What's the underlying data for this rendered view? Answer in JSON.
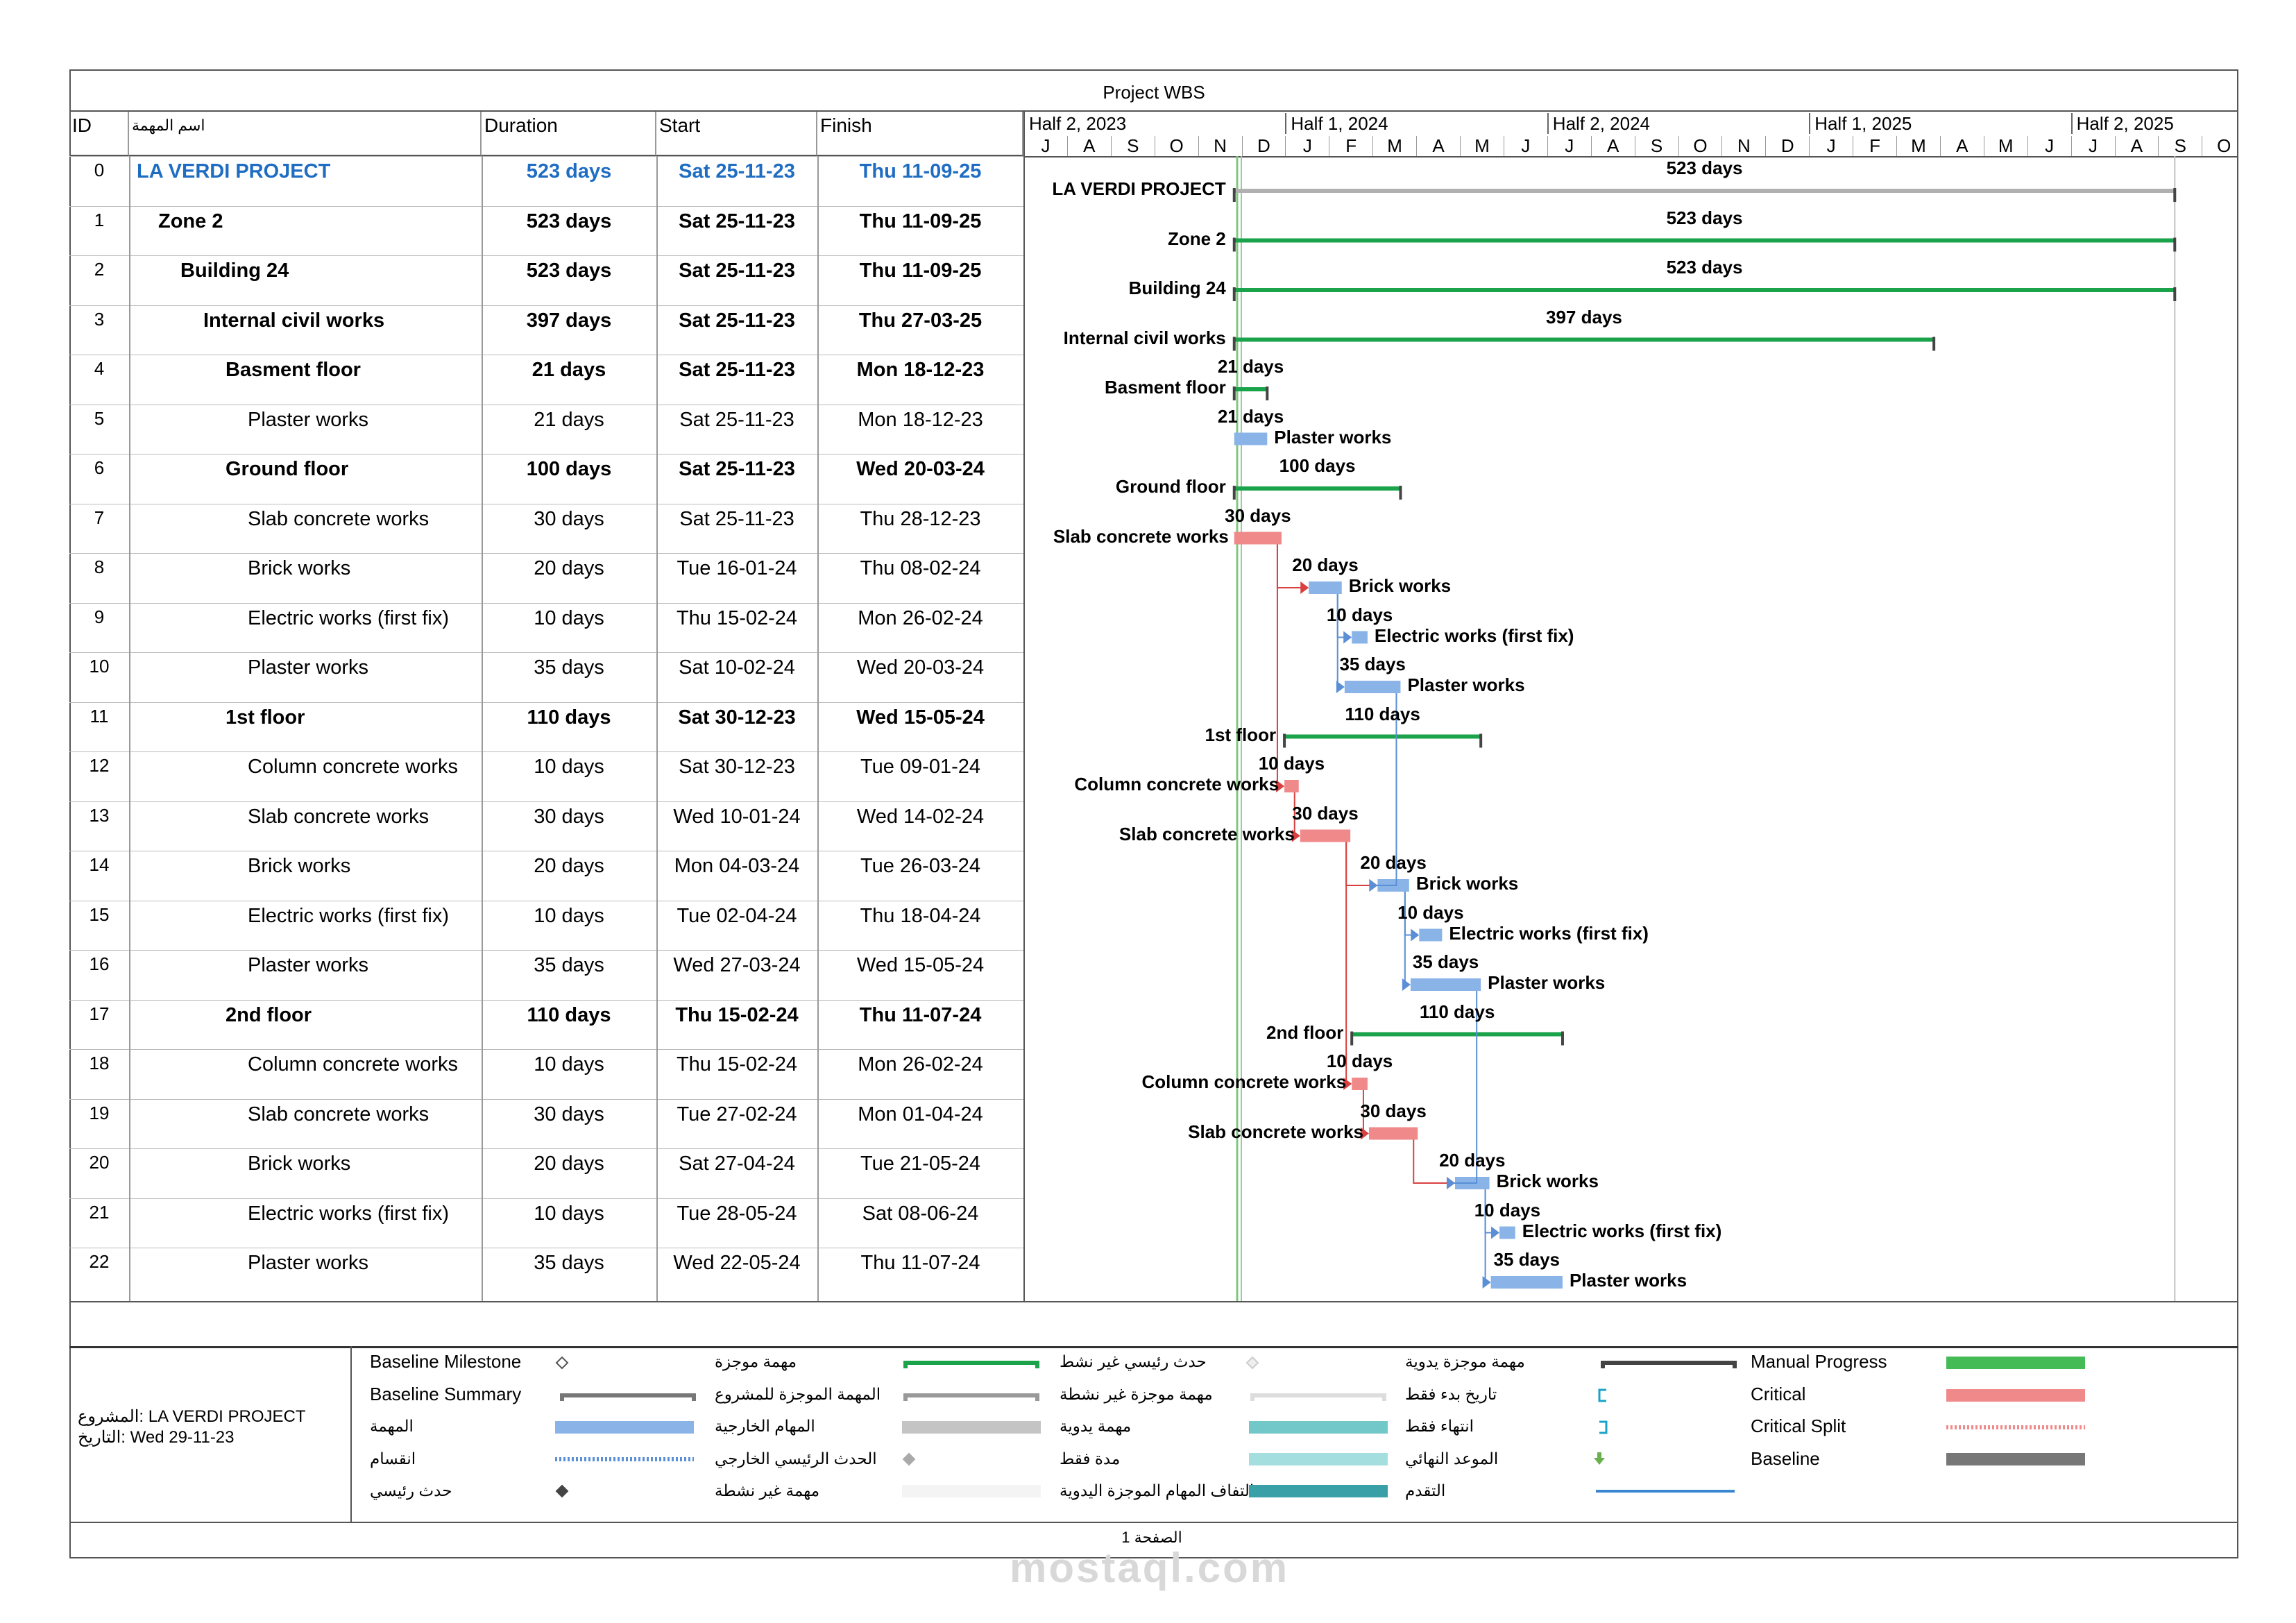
{
  "header": {
    "title": "Project WBS",
    "col_id": "ID",
    "col_name": "اسم المهمة",
    "col_duration": "Duration",
    "col_start": "Start",
    "col_finish": "Finish"
  },
  "timeline": {
    "halves": [
      "Half 2, 2023",
      "Half 1, 2024",
      "Half 2, 2024",
      "Half 1, 2025",
      "Half 2, 2025"
    ],
    "months": [
      "J",
      "A",
      "S",
      "O",
      "N",
      "D",
      "J",
      "F",
      "M",
      "A",
      "M",
      "J",
      "J",
      "A",
      "S",
      "O",
      "N",
      "D",
      "J",
      "F",
      "M",
      "A",
      "M",
      "J",
      "J",
      "A",
      "S",
      "O"
    ]
  },
  "tasks": [
    {
      "id": "0",
      "name": "LA VERDI PROJECT",
      "duration": "523 days",
      "start": "Sat 25-11-23",
      "finish": "Thu 11-09-25",
      "level": 0,
      "type": "project",
      "bar_label": "523 days",
      "gantt_name": "LA VERDI PROJECT"
    },
    {
      "id": "1",
      "name": "Zone 2",
      "duration": "523 days",
      "start": "Sat 25-11-23",
      "finish": "Thu 11-09-25",
      "level": 1,
      "type": "summary",
      "bar_label": "523 days",
      "gantt_name": "Zone 2"
    },
    {
      "id": "2",
      "name": "Building 24",
      "duration": "523 days",
      "start": "Sat 25-11-23",
      "finish": "Thu 11-09-25",
      "level": 2,
      "type": "summary",
      "bar_label": "523 days",
      "gantt_name": "Building 24"
    },
    {
      "id": "3",
      "name": "Internal civil works",
      "duration": "397 days",
      "start": "Sat 25-11-23",
      "finish": "Thu 27-03-25",
      "level": 3,
      "type": "summary",
      "bar_label": "397 days",
      "gantt_name": "Internal civil works"
    },
    {
      "id": "4",
      "name": "Basment floor",
      "duration": "21 days",
      "start": "Sat 25-11-23",
      "finish": "Mon 18-12-23",
      "level": 4,
      "type": "summary",
      "bar_label": "21 days",
      "gantt_name": "Basment floor"
    },
    {
      "id": "5",
      "name": "Plaster works",
      "duration": "21 days",
      "start": "Sat 25-11-23",
      "finish": "Mon 18-12-23",
      "level": 5,
      "type": "task",
      "bar_label": "21 days",
      "gantt_name": "Plaster works"
    },
    {
      "id": "6",
      "name": "Ground floor",
      "duration": "100 days",
      "start": "Sat 25-11-23",
      "finish": "Wed 20-03-24",
      "level": 4,
      "type": "summary",
      "bar_label": "100 days",
      "gantt_name": "Ground floor"
    },
    {
      "id": "7",
      "name": "Slab concrete works",
      "duration": "30 days",
      "start": "Sat 25-11-23",
      "finish": "Thu 28-12-23",
      "level": 5,
      "type": "critical",
      "bar_label": "30 days",
      "gantt_name": "Slab concrete works"
    },
    {
      "id": "8",
      "name": "Brick works",
      "duration": "20 days",
      "start": "Tue 16-01-24",
      "finish": "Thu 08-02-24",
      "level": 5,
      "type": "task",
      "bar_label": "20 days",
      "gantt_name": "Brick works"
    },
    {
      "id": "9",
      "name": "Electric works (first fix)",
      "duration": "10 days",
      "start": "Thu 15-02-24",
      "finish": "Mon 26-02-24",
      "level": 5,
      "type": "task",
      "bar_label": "10 days",
      "gantt_name": "Electric works (first fix)"
    },
    {
      "id": "10",
      "name": "Plaster works",
      "duration": "35 days",
      "start": "Sat 10-02-24",
      "finish": "Wed 20-03-24",
      "level": 5,
      "type": "task",
      "bar_label": "35 days",
      "gantt_name": "Plaster works"
    },
    {
      "id": "11",
      "name": "1st floor",
      "duration": "110 days",
      "start": "Sat 30-12-23",
      "finish": "Wed 15-05-24",
      "level": 4,
      "type": "summary",
      "bar_label": "110 days",
      "gantt_name": "1st floor"
    },
    {
      "id": "12",
      "name": "Column concrete works",
      "duration": "10 days",
      "start": "Sat 30-12-23",
      "finish": "Tue 09-01-24",
      "level": 5,
      "type": "critical",
      "bar_label": "10 days",
      "gantt_name": "Column concrete works"
    },
    {
      "id": "13",
      "name": "Slab concrete works",
      "duration": "30 days",
      "start": "Wed 10-01-24",
      "finish": "Wed 14-02-24",
      "level": 5,
      "type": "critical",
      "bar_label": "30 days",
      "gantt_name": "Slab concrete works"
    },
    {
      "id": "14",
      "name": "Brick works",
      "duration": "20 days",
      "start": "Mon 04-03-24",
      "finish": "Tue 26-03-24",
      "level": 5,
      "type": "task",
      "bar_label": "20 days",
      "gantt_name": "Brick works"
    },
    {
      "id": "15",
      "name": "Electric works (first fix)",
      "duration": "10 days",
      "start": "Tue 02-04-24",
      "finish": "Thu 18-04-24",
      "level": 5,
      "type": "task",
      "bar_label": "10 days",
      "gantt_name": "Electric works (first fix)"
    },
    {
      "id": "16",
      "name": "Plaster works",
      "duration": "35 days",
      "start": "Wed 27-03-24",
      "finish": "Wed 15-05-24",
      "level": 5,
      "type": "task",
      "bar_label": "35 days",
      "gantt_name": "Plaster works"
    },
    {
      "id": "17",
      "name": "2nd floor",
      "duration": "110 days",
      "start": "Thu 15-02-24",
      "finish": "Thu 11-07-24",
      "level": 4,
      "type": "summary",
      "bar_label": "110 days",
      "gantt_name": "2nd floor"
    },
    {
      "id": "18",
      "name": "Column concrete works",
      "duration": "10 days",
      "start": "Thu 15-02-24",
      "finish": "Mon 26-02-24",
      "level": 5,
      "type": "critical",
      "bar_label": "10 days",
      "gantt_name": "Column concrete works"
    },
    {
      "id": "19",
      "name": "Slab concrete works",
      "duration": "30 days",
      "start": "Tue 27-02-24",
      "finish": "Mon 01-04-24",
      "level": 5,
      "type": "critical",
      "bar_label": "30 days",
      "gantt_name": "Slab concrete works"
    },
    {
      "id": "20",
      "name": "Brick works",
      "duration": "20 days",
      "start": "Sat 27-04-24",
      "finish": "Tue 21-05-24",
      "level": 5,
      "type": "task",
      "bar_label": "20 days",
      "gantt_name": "Brick works"
    },
    {
      "id": "21",
      "name": "Electric works (first fix)",
      "duration": "10 days",
      "start": "Tue 28-05-24",
      "finish": "Sat 08-06-24",
      "level": 5,
      "type": "task",
      "bar_label": "10 days",
      "gantt_name": "Electric works (first fix)"
    },
    {
      "id": "22",
      "name": "Plaster works",
      "duration": "35 days",
      "start": "Wed 22-05-24",
      "finish": "Thu 11-07-24",
      "level": 5,
      "type": "task",
      "bar_label": "35 days",
      "gantt_name": "Plaster works"
    }
  ],
  "legend": {
    "project_label": "المشروع: LA VERDI PROJECT",
    "date_label": "التاريخ: Wed 29-11-23",
    "items": [
      [
        "Baseline Milestone",
        "مهمة موجزة",
        "حدث رئيسي غير نشط",
        "مهمة موجزة يدوية",
        "Manual Progress"
      ],
      [
        "Baseline Summary",
        "المهمة الموجزة للمشروع",
        "مهمة موجزة غير نشطة",
        "تاريخ بدء فقط",
        "Critical"
      ],
      [
        "المهمة",
        "المهام الخارجية",
        "مهمة يدوية",
        "انتهاء فقط",
        "Critical Split"
      ],
      [
        "انقسام",
        "الحدث الرئيسي الخارجي",
        "مدة فقط",
        "الموعد النهائي",
        "Baseline"
      ],
      [
        "حدث رئيسي",
        "مهمة غير نشطة",
        "التفاف المهام الموجزة اليدوية",
        "التقدم",
        ""
      ]
    ]
  },
  "footer": {
    "page_label": "الصفحة 1"
  },
  "watermark": {
    "text": "mostaql.com"
  },
  "colors": {
    "summary_green": "#1aa34a",
    "project_gray": "#b0b0b0",
    "task_blue": "#8ab4e8",
    "critical_red": "#f08a8a",
    "link_blue": "#5a8fd6",
    "link_red": "#d94040",
    "accent_blue": "#1f6dc3"
  }
}
